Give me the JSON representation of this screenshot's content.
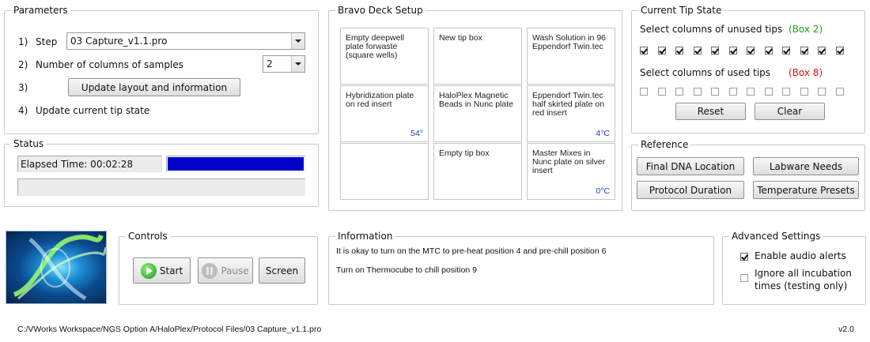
{
  "parameters": {
    "legend": "Parameters",
    "step_num": "1)",
    "step_label": "Step",
    "step_value": "03 Capture_v1.1.pro",
    "columns_num": "2)",
    "columns_label": "Number of columns of samples",
    "columns_value": "2",
    "update_num": "3)",
    "update_button": "Update layout and information",
    "tip_num": "4)",
    "tip_label": "Update current tip state"
  },
  "status": {
    "legend": "Status",
    "elapsed": "Elapsed Time: 00:02:28",
    "progress_fill": 1.0,
    "progress_color": "#0000c8"
  },
  "deck": {
    "legend": "Bravo Deck Setup",
    "cells": [
      {
        "label": "Empty deepwell plate forwaste (square wells)",
        "temp": ""
      },
      {
        "label": "New tip box",
        "temp": ""
      },
      {
        "label": "Wash Solution in 96 Eppendorf Twin.tec",
        "temp": ""
      },
      {
        "label": "Hybridization plate on red insert",
        "temp": "54°"
      },
      {
        "label": "HaloPlex Magnetic Beads in Nunc plate",
        "temp": ""
      },
      {
        "label": "Eppendorf Twin.tec half skirted plate on red insert",
        "temp": "4°C"
      },
      {
        "label": "",
        "temp": ""
      },
      {
        "label": "Empty tip box",
        "temp": ""
      },
      {
        "label": "Master Mixes in Nunc plate on silver insert",
        "temp": "0°C"
      }
    ]
  },
  "tips": {
    "legend": "Current Tip State",
    "unused_label": "Select columns of unused tips",
    "unused_box": "(Box 2)",
    "unused_color": "#1a9a1a",
    "unused_checks": [
      true,
      true,
      true,
      true,
      true,
      true,
      true,
      true,
      true,
      true,
      true,
      true
    ],
    "used_label": "Select columns of used tips",
    "used_box": "(Box 8)",
    "used_color": "#e01010",
    "used_checks": [
      false,
      false,
      false,
      false,
      false,
      false,
      false,
      false,
      false,
      false,
      false,
      false
    ],
    "reset_button": "Reset",
    "clear_button": "Clear"
  },
  "reference": {
    "legend": "Reference",
    "buttons": [
      "Final DNA Location",
      "Labware Needs",
      "Protocol Duration",
      "Temperature Presets"
    ]
  },
  "controls": {
    "legend": "Controls",
    "start": "Start",
    "pause": "Pause",
    "screen": "Screen"
  },
  "information": {
    "legend": "Information",
    "lines": [
      "It is okay to turn on the MTC to pre-heat position 4 and pre-chill position 6",
      "Turn on Thermocube to chill position 9"
    ]
  },
  "advanced": {
    "legend": "Advanced Settings",
    "audio_label": "Enable audio alerts",
    "audio_checked": true,
    "ignore_label_1": "Ignore all incubation",
    "ignore_label_2": "times (testing only)",
    "ignore_checked": false
  },
  "footer": {
    "path": "C:/VWorks Workspace/NGS Option A/HaloPlex/Protocol Files/03 Capture_v1.1.pro",
    "version": "v2.0"
  }
}
